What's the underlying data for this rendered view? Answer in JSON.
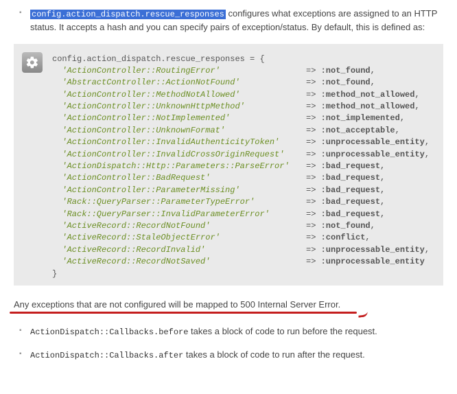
{
  "intro": {
    "config_key": "config.action_dispatch.rescue_responses",
    "desc_after": " configures what exceptions are assigned to an HTTP status. It accepts a hash and you can specify pairs of exception/status. By default, this is defined as:"
  },
  "code_header": "config.action_dispatch.rescue_responses = {",
  "mappings": [
    {
      "exception": "ActionController::RoutingError",
      "status": ":not_found",
      "trail": ","
    },
    {
      "exception": "AbstractController::ActionNotFound",
      "status": ":not_found",
      "trail": ","
    },
    {
      "exception": "ActionController::MethodNotAllowed",
      "status": ":method_not_allowed",
      "trail": ","
    },
    {
      "exception": "ActionController::UnknownHttpMethod",
      "status": ":method_not_allowed",
      "trail": ","
    },
    {
      "exception": "ActionController::NotImplemented",
      "status": ":not_implemented",
      "trail": ","
    },
    {
      "exception": "ActionController::UnknownFormat",
      "status": ":not_acceptable",
      "trail": ","
    },
    {
      "exception": "ActionController::InvalidAuthenticityToken",
      "status": ":unprocessable_entity",
      "trail": ","
    },
    {
      "exception": "ActionController::InvalidCrossOriginRequest",
      "status": ":unprocessable_entity",
      "trail": ","
    },
    {
      "exception": "ActionDispatch::Http::Parameters::ParseError",
      "status": ":bad_request",
      "trail": ","
    },
    {
      "exception": "ActionController::BadRequest",
      "status": ":bad_request",
      "trail": ","
    },
    {
      "exception": "ActionController::ParameterMissing",
      "status": ":bad_request",
      "trail": ","
    },
    {
      "exception": "Rack::QueryParser::ParameterTypeError",
      "status": ":bad_request",
      "trail": ","
    },
    {
      "exception": "Rack::QueryParser::InvalidParameterError",
      "status": ":bad_request",
      "trail": ","
    },
    {
      "exception": "ActiveRecord::RecordNotFound",
      "status": ":not_found",
      "trail": ","
    },
    {
      "exception": "ActiveRecord::StaleObjectError",
      "status": ":conflict",
      "trail": ","
    },
    {
      "exception": "ActiveRecord::RecordInvalid",
      "status": ":unprocessable_entity",
      "trail": ","
    },
    {
      "exception": "ActiveRecord::RecordNotSaved",
      "status": ":unprocessable_entity",
      "trail": ""
    }
  ],
  "code_footer": "}",
  "note": "Any exceptions that are not configured will be mapped to 500 Internal Server Error.",
  "callbacks": [
    {
      "code": "ActionDispatch::Callbacks.before",
      "desc": " takes a block of code to run before the request."
    },
    {
      "code": "ActionDispatch::Callbacks.after",
      "desc": " takes a block of code to run after the request."
    }
  ]
}
